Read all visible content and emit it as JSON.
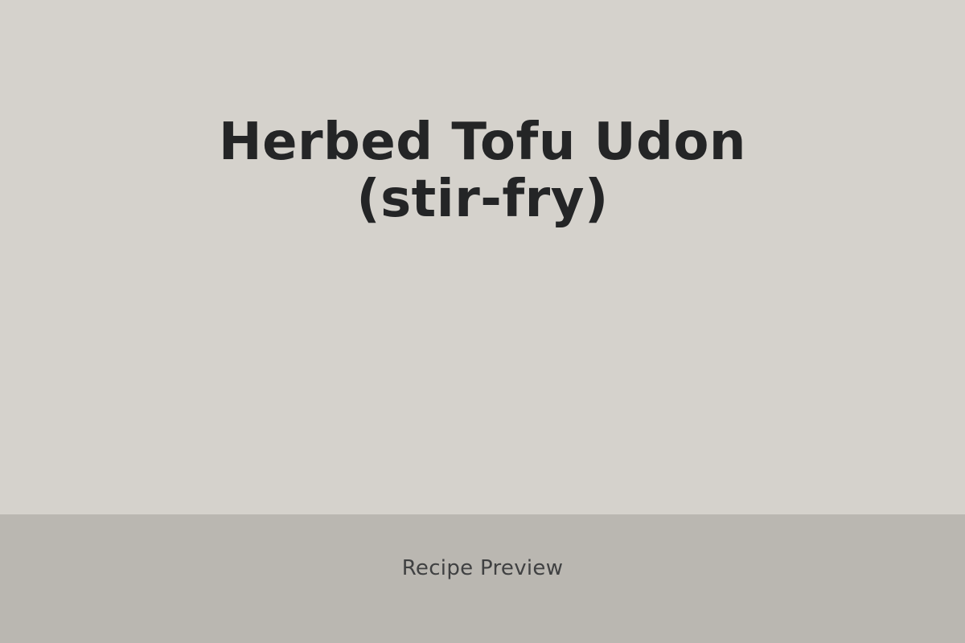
{
  "recipe": {
    "title_line_1": "Herbed Tofu Udon",
    "title_line_2": "(stir-fry)"
  },
  "footer": {
    "label": "Recipe Preview"
  },
  "colors": {
    "background": "#d5d2cc",
    "footer_background": "#bab7b1",
    "title_text": "#242526",
    "footer_text": "#404142"
  }
}
